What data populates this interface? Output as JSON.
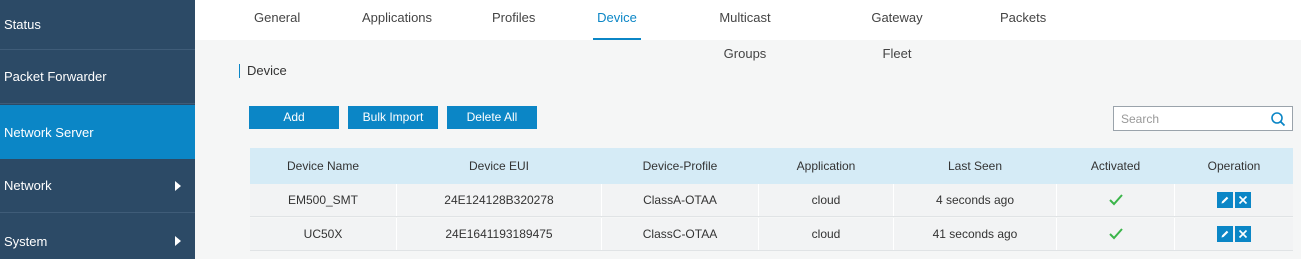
{
  "sidebar": {
    "items": [
      {
        "label": "Status"
      },
      {
        "label": "Packet Forwarder"
      },
      {
        "label": "Network Server"
      },
      {
        "label": "Network"
      },
      {
        "label": "System"
      }
    ]
  },
  "tabs": [
    {
      "label": "General"
    },
    {
      "label": "Applications"
    },
    {
      "label": "Profiles"
    },
    {
      "label": "Device"
    },
    {
      "label": "Multicast Groups"
    },
    {
      "label": "Gateway Fleet"
    },
    {
      "label": "Packets"
    }
  ],
  "section": {
    "title": "Device"
  },
  "toolbar": {
    "add_label": "Add",
    "bulk_import_label": "Bulk Import",
    "delete_all_label": "Delete All"
  },
  "search": {
    "placeholder": "Search"
  },
  "table": {
    "headers": [
      "Device Name",
      "Device EUI",
      "Device-Profile",
      "Application",
      "Last Seen",
      "Activated",
      "Operation"
    ],
    "rows": [
      {
        "name": "EM500_SMT",
        "eui": "24E124128B320278",
        "profile": "ClassA-OTAA",
        "application": "cloud",
        "last_seen": "4 seconds ago",
        "activated": true
      },
      {
        "name": "UC50X",
        "eui": "24E1641193189475",
        "profile": "ClassC-OTAA",
        "application": "cloud",
        "last_seen": "41 seconds ago",
        "activated": true
      }
    ]
  },
  "colors": {
    "sidebar_bg": "#2c4a66",
    "accent": "#0b86c6",
    "table_header_bg": "#d5ebf6",
    "check_color": "#3bb54a"
  }
}
